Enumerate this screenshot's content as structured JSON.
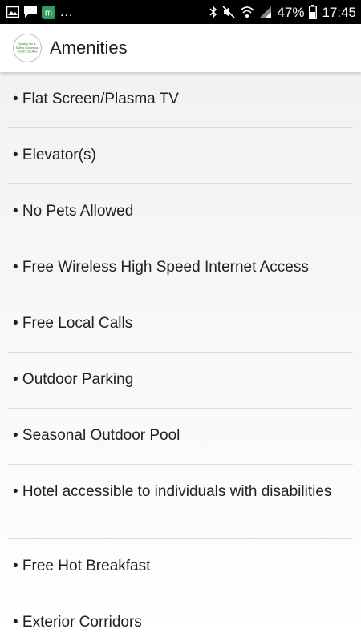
{
  "status_bar": {
    "icons_left": [
      "image-icon",
      "message-icon",
      "app-m-icon"
    ],
    "overflow": "...",
    "icons_right": [
      "bluetooth-icon",
      "mute-icon",
      "wifi-icon",
      "signal-icon"
    ],
    "battery_percent": "47%",
    "time": "17:45",
    "app_icon_letter": "m",
    "app_icon_color": "#2e9e5b"
  },
  "app_bar": {
    "title": "Amenities",
    "logo_icon": "hotel-logo-icon",
    "logo_text": [
      "Quality Inn &",
      "Suites Columbia,",
      "South Carolina"
    ]
  },
  "amenities": [
    "• Flat Screen/Plasma TV",
    "• Elevator(s)",
    "• No Pets Allowed",
    "• Free Wireless High Speed Internet Access",
    "• Free Local Calls",
    "• Outdoor Parking",
    "• Seasonal Outdoor Pool",
    "• Hotel accessible to individuals with disabilities",
    "• Free Hot Breakfast",
    "• Exterior Corridors"
  ]
}
